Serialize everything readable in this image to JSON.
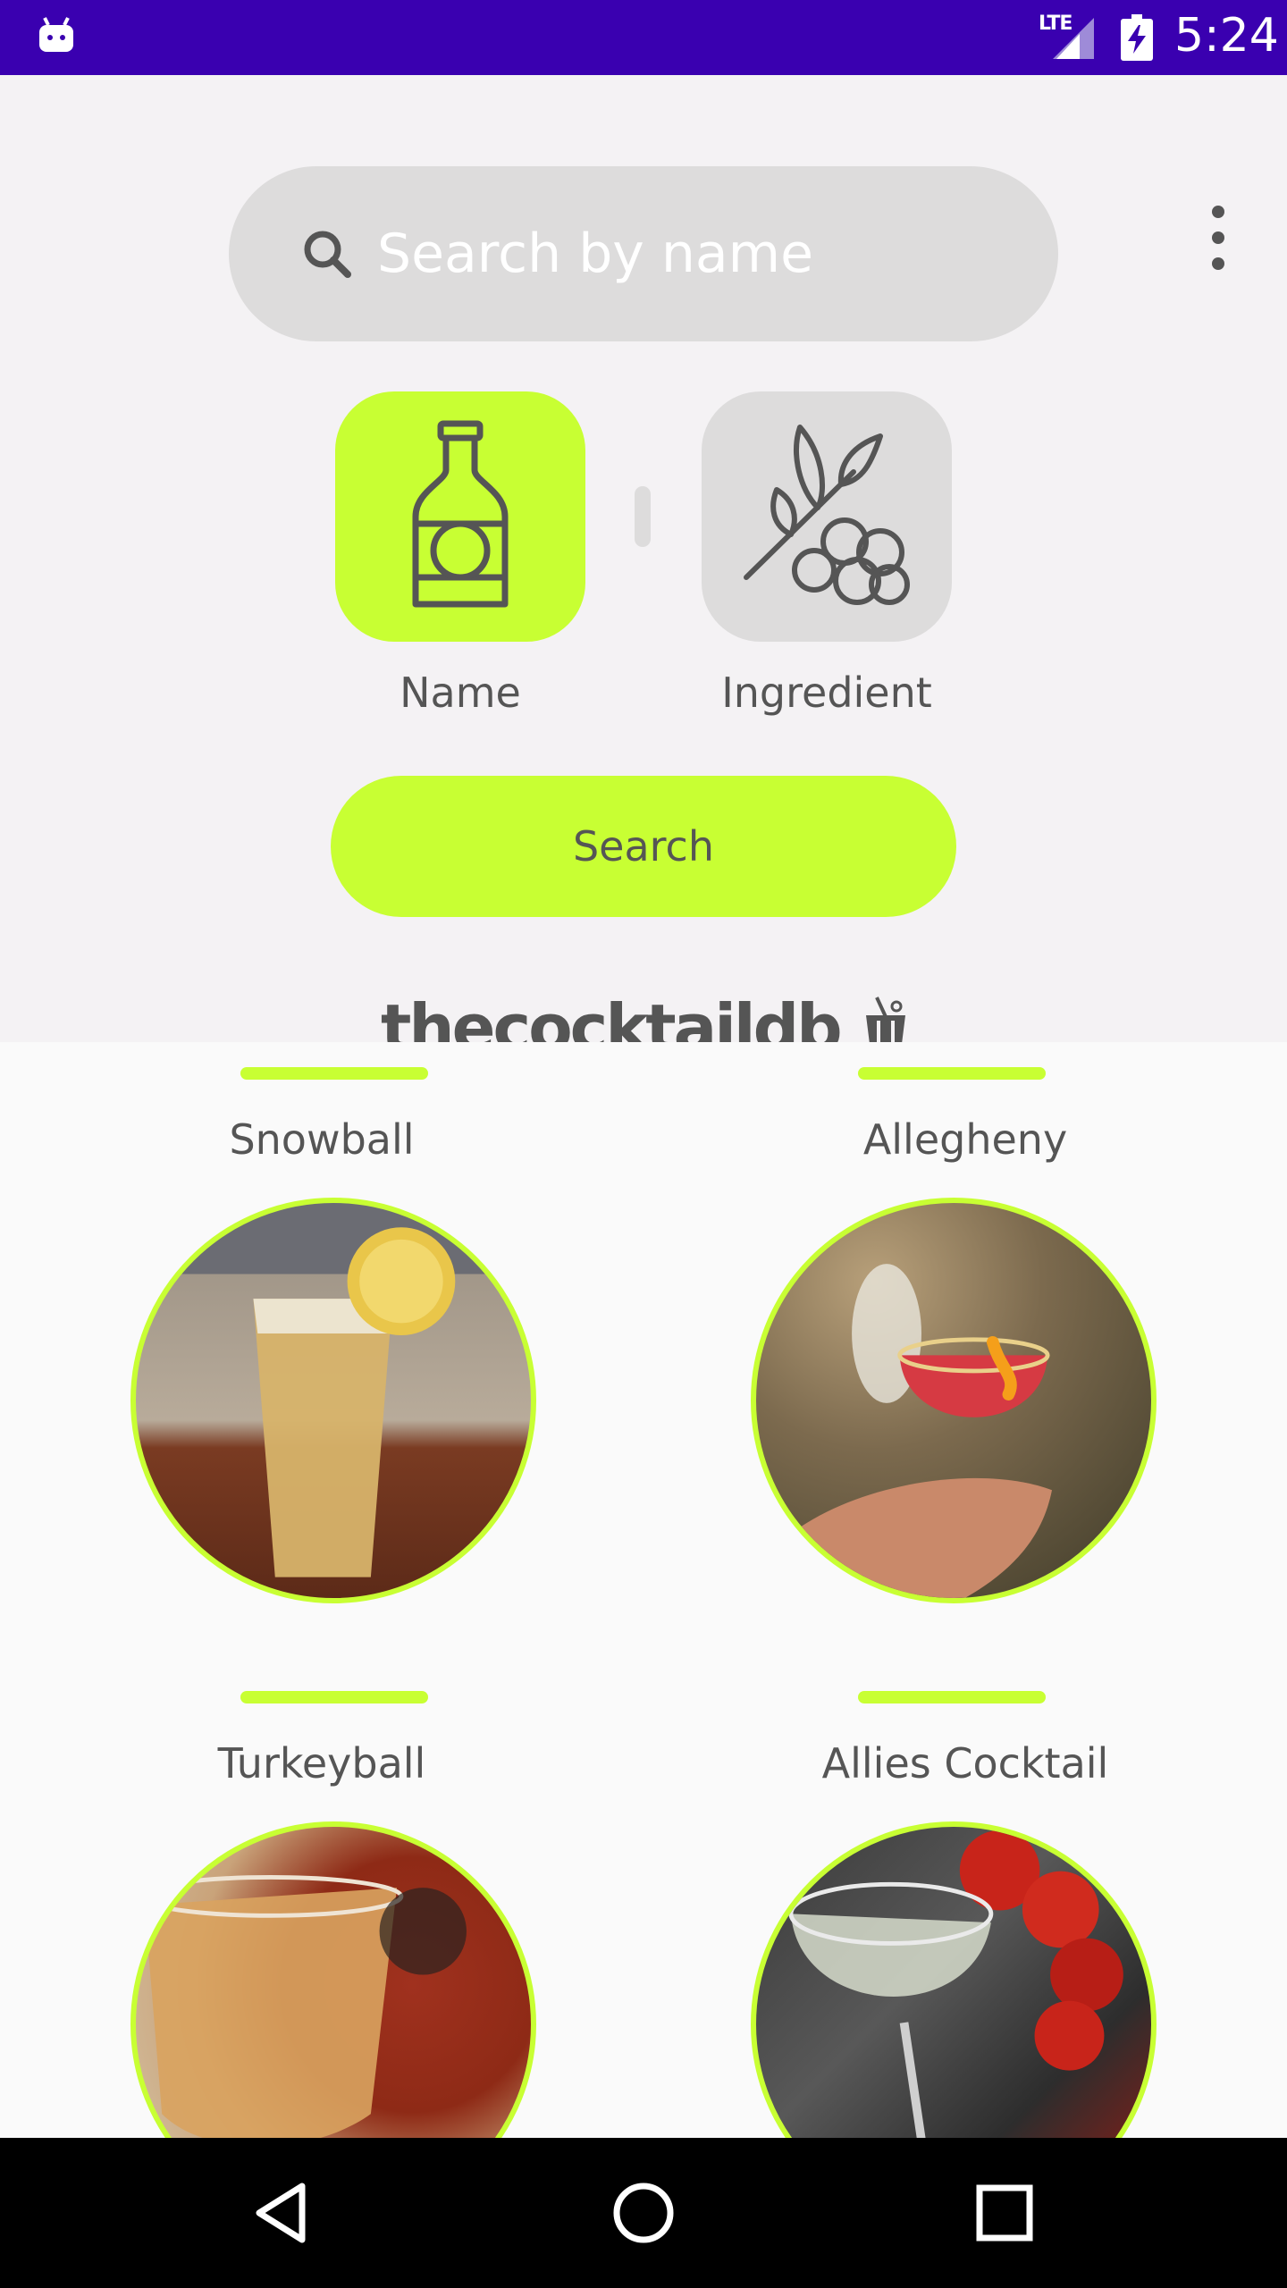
{
  "status_bar": {
    "network": "LTE",
    "time": "5:24"
  },
  "search": {
    "placeholder": "Search by name",
    "value": ""
  },
  "toggles": {
    "name_label": "Name",
    "ingredient_label": "Ingredient",
    "selected": "Name"
  },
  "search_button": {
    "label": "Search"
  },
  "brand": {
    "text": "thecocktaildb"
  },
  "cocktails": [
    {
      "name": "Snowball"
    },
    {
      "name": "Allegheny"
    },
    {
      "name": "Turkeyball"
    },
    {
      "name": "Allies Cocktail"
    }
  ],
  "colors": {
    "accent": "#c8ff33",
    "status_bar": "#3a00b0",
    "chip_inactive": "#dddcdc",
    "text": "#555555"
  },
  "icons": {
    "menu": "overflow-menu-icon",
    "search": "search-icon",
    "name_toggle": "bottle-icon",
    "ingredient_toggle": "berries-branch-icon"
  }
}
